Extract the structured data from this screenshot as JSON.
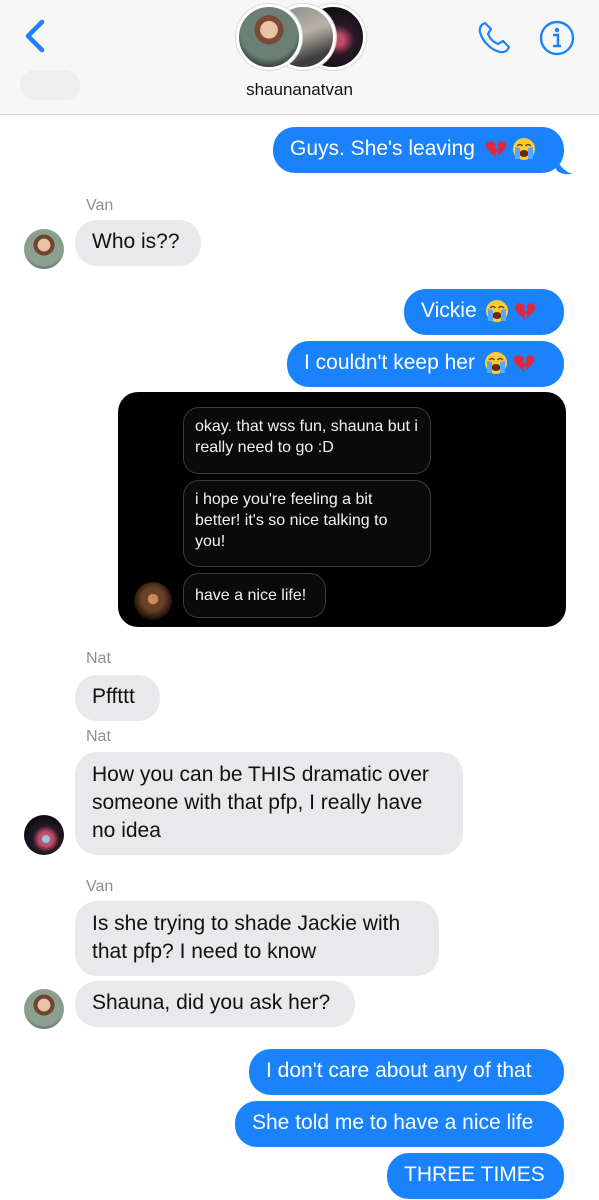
{
  "header": {
    "title": "shaunanatvan"
  },
  "messages": [
    {
      "side": "out",
      "text": "Guys. She's leaving",
      "emojis": [
        "broken-heart-icon",
        "loudly-crying-face-icon"
      ]
    },
    {
      "side": "in",
      "sender": "Van",
      "text": "Who is??"
    },
    {
      "side": "out",
      "text": "Vickie",
      "emojis": [
        "loudly-crying-face-icon",
        "broken-heart-icon"
      ]
    },
    {
      "side": "out",
      "text": "I couldn't keep her",
      "emojis": [
        "loudly-crying-face-icon",
        "broken-heart-icon"
      ]
    },
    {
      "side": "in",
      "sender": "Nat",
      "text": "Pffttt"
    },
    {
      "side": "in",
      "sender": "Nat",
      "text": "How you can be THIS dramatic over someone with that pfp, I really have no idea"
    },
    {
      "side": "in",
      "sender": "Van",
      "text": "Is she trying to shade Jackie with that pfp? I need to know"
    },
    {
      "side": "in",
      "text": "Shauna, did you ask her?"
    },
    {
      "side": "out",
      "text": "I don't care about any of that"
    },
    {
      "side": "out",
      "text": "She told me to have a nice life"
    },
    {
      "side": "out",
      "text": "THREE TIMES"
    }
  ],
  "screenshot": {
    "messages": [
      "okay. that wss fun, shauna but i really need to go :D",
      "i hope you're feeling a bit better! it's so nice talking to you!",
      "have a nice life!"
    ]
  },
  "colors": {
    "outgoing": "#1a82fb",
    "incoming": "#e9e9eb",
    "accent": "#1a82fb"
  }
}
